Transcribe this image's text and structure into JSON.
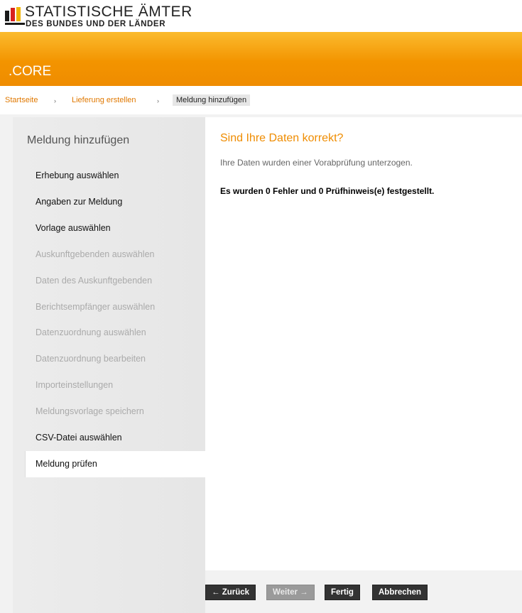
{
  "brand": {
    "line1": "STATISTISCHE ÄMTER",
    "line2": "DES BUNDES UND DER LÄNDER"
  },
  "header": {
    "title": ".CORE"
  },
  "breadcrumb": {
    "items": [
      "Startseite",
      "Lieferung erstellen",
      "Meldung hinzufügen"
    ],
    "separator": "›"
  },
  "sidebar": {
    "title": "Meldung hinzufügen",
    "items": [
      {
        "label": "Erhebung auswählen",
        "state": "enabled"
      },
      {
        "label": "Angaben zur Meldung",
        "state": "enabled"
      },
      {
        "label": "Vorlage auswählen",
        "state": "enabled"
      },
      {
        "label": "Auskunftgebenden auswählen",
        "state": "disabled"
      },
      {
        "label": "Daten des Auskunftgebenden",
        "state": "disabled"
      },
      {
        "label": "Berichtsempfänger auswählen",
        "state": "disabled"
      },
      {
        "label": "Datenzuordnung auswählen",
        "state": "disabled"
      },
      {
        "label": "Datenzuordnung bearbeiten",
        "state": "disabled"
      },
      {
        "label": "Importeinstellungen",
        "state": "disabled"
      },
      {
        "label": "Meldungsvorlage speichern",
        "state": "disabled"
      },
      {
        "label": "CSV-Datei auswählen",
        "state": "enabled"
      },
      {
        "label": "Meldung prüfen",
        "state": "active"
      }
    ]
  },
  "main": {
    "title": "Sind Ihre Daten korrekt?",
    "subtitle": "Ihre Daten wurden einer Vorabprüfung unterzogen.",
    "message": "Es wurden 0 Fehler und 0 Prüfhinweis(e) festgestellt."
  },
  "buttons": {
    "back": "Zurück",
    "next": "Weiter",
    "finish": "Fertig",
    "cancel": "Abbrechen"
  },
  "icons": {
    "arrow_left": "arrow-left-icon",
    "arrow_right": "arrow-right-icon",
    "chevron_right": "chevron-right-icon"
  },
  "colors": {
    "accent": "#ef8c00",
    "header_top": "#fbbb2e",
    "header_bottom": "#ef8c00",
    "button": "#333333",
    "button_disabled": "#9a9a9a"
  }
}
